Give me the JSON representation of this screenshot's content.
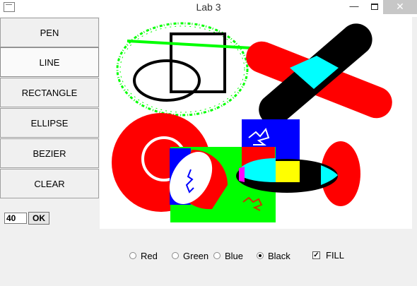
{
  "window": {
    "title": "Lab 3",
    "close_glyph": "✕",
    "min_glyph": "—"
  },
  "tools": [
    {
      "label": "PEN"
    },
    {
      "label": "LINE",
      "active": true
    },
    {
      "label": "RECTANGLE"
    },
    {
      "label": "ELLIPSE"
    },
    {
      "label": "BEZIER"
    },
    {
      "label": "CLEAR"
    }
  ],
  "size_input": {
    "value": "40"
  },
  "ok_button": {
    "label": "OK"
  },
  "colors": {
    "options": [
      {
        "label": "Red",
        "selected": false
      },
      {
        "label": "Green",
        "selected": false
      },
      {
        "label": "Blue",
        "selected": false
      },
      {
        "label": "Black",
        "selected": true
      }
    ]
  },
  "fill": {
    "label": "FILL",
    "checked": true,
    "check_glyph": "✓"
  },
  "palette": {
    "red": "#ff0000",
    "green": "#00ff00",
    "blue": "#0000ff",
    "black": "#000000",
    "cyan": "#00ffff",
    "yellow": "#ffff00",
    "magenta": "#ff00ff"
  }
}
